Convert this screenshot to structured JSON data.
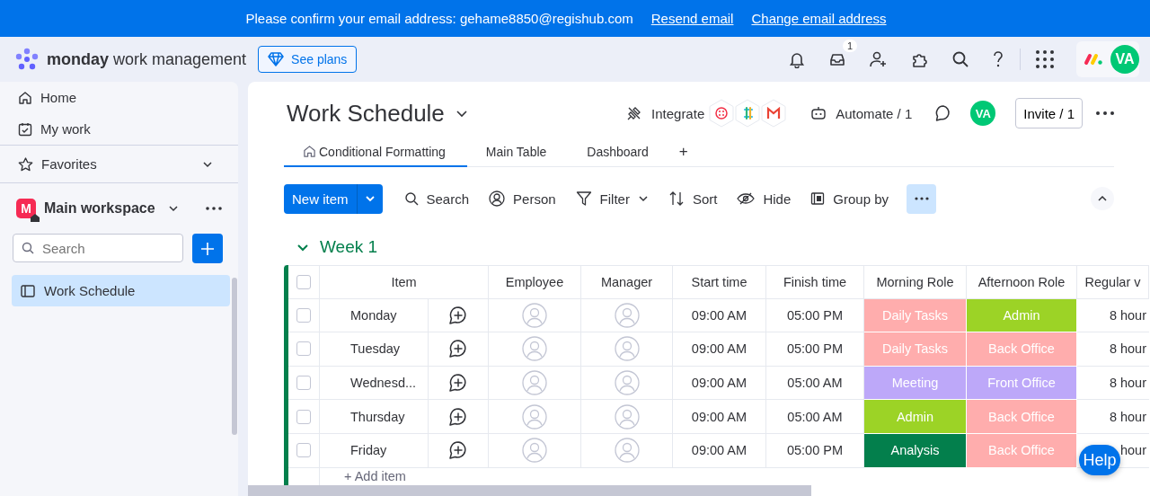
{
  "banner": {
    "message": "Please confirm your email address: gehame8850@regishub.com",
    "links": [
      "Resend email",
      "Change email address"
    ]
  },
  "header": {
    "brand": "monday",
    "product": "work management",
    "plans_button": "See plans",
    "notification_count": "1",
    "avatar": "VA"
  },
  "sidebar": {
    "nav": [
      {
        "label": "Home",
        "kind": "home"
      },
      {
        "label": "My work",
        "kind": "calendar"
      }
    ],
    "favorites": "Favorites",
    "workspace": {
      "badge": "M",
      "name": "Main workspace"
    },
    "search": {
      "placeholder": "Search"
    },
    "boards": [
      {
        "label": "Work Schedule",
        "selected": true
      }
    ]
  },
  "board": {
    "title": "Work Schedule",
    "integrate": "Integrate",
    "automate": "Automate / 1",
    "avatar": "VA",
    "invite": "Invite / 1",
    "tabs": [
      {
        "label": "Conditional Formatting",
        "selected": true,
        "kind": "home"
      },
      {
        "label": "Main Table",
        "selected": false,
        "kind": "plain"
      },
      {
        "label": "Dashboard",
        "selected": false,
        "kind": "plain"
      }
    ],
    "add_tab": "+",
    "toolbar": {
      "new_item": "New item",
      "actions": [
        {
          "label": "Search",
          "kind": "search"
        },
        {
          "label": "Person",
          "kind": "person"
        },
        {
          "label": "Filter",
          "kind": "filter"
        },
        {
          "label": "Sort",
          "kind": "sort"
        },
        {
          "label": "Hide",
          "kind": "hide"
        },
        {
          "label": "Group by",
          "kind": "group"
        }
      ]
    },
    "group": {
      "name": "Week 1",
      "all_checked": false,
      "columns": [
        "Item",
        "Employee",
        "Manager",
        "Start time",
        "Finish time",
        "Morning Role",
        "Afternoon Role",
        "Regular v"
      ],
      "rows": [
        {
          "item": "Monday",
          "checked": false,
          "start": "09:00 AM",
          "finish": "05:00 PM",
          "morning": {
            "label": "Daily Tasks",
            "color": "#ffadad"
          },
          "afternoon": {
            "label": "Admin",
            "color": "#9cd326"
          },
          "regular": "8 hour"
        },
        {
          "item": "Tuesday",
          "checked": false,
          "start": "09:00 AM",
          "finish": "05:00 PM",
          "morning": {
            "label": "Daily Tasks",
            "color": "#ffadad"
          },
          "afternoon": {
            "label": "Back Office",
            "color": "#ffadad"
          },
          "regular": "8 hour"
        },
        {
          "item": "Wednesd...",
          "checked": false,
          "start": "09:00 AM",
          "finish": "05:00 AM",
          "morning": {
            "label": "Meeting",
            "color": "#bda8f9"
          },
          "afternoon": {
            "label": "Front Office",
            "color": "#bda8f9"
          },
          "regular": "8 hour"
        },
        {
          "item": "Thursday",
          "checked": false,
          "start": "09:00 AM",
          "finish": "05:00 AM",
          "morning": {
            "label": "Admin",
            "color": "#9cd326"
          },
          "afternoon": {
            "label": "Back Office",
            "color": "#ffadad"
          },
          "regular": "8 hour"
        },
        {
          "item": "Friday",
          "checked": false,
          "start": "09:00 AM",
          "finish": "05:00 PM",
          "morning": {
            "label": "Analysis",
            "color": "#037f4c"
          },
          "afternoon": {
            "label": "Back Office",
            "color": "#ffadad"
          },
          "regular": "hour"
        }
      ],
      "add_item": "+ Add item"
    }
  },
  "help": "Help"
}
